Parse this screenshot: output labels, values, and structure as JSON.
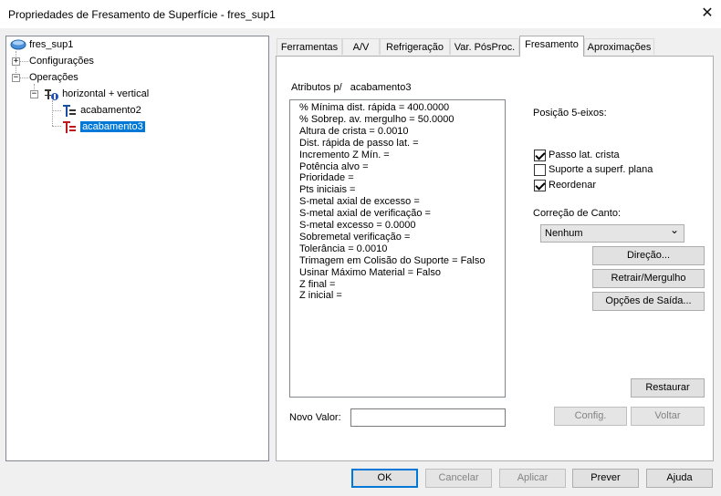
{
  "window": {
    "title": "Propriedades de Fresamento de Superfície - fres_sup1",
    "close_glyph": "✕"
  },
  "tree": {
    "root": "fres_sup1",
    "configuracoes": "Configurações",
    "operacoes": "Operações",
    "group": "horizontal + vertical",
    "items": [
      "acabamento2",
      "acabamento3"
    ],
    "selected": "acabamento3",
    "collapsed_glyph": "+",
    "expanded_glyph": "−"
  },
  "tabs": [
    "Ferramentas",
    "A/V",
    "Refrigeração",
    "Var. PósProc.",
    "Fresamento",
    "Aproximações"
  ],
  "active_tab": "Fresamento",
  "attributes": {
    "header": "Atributos p/   acabamento3",
    "lines": [
      "% Mínima dist. rápida = 400.0000",
      "% Sobrep. av. mergulho = 50.0000",
      "Altura de crista = 0.0010",
      "Dist. rápida de passo lat. =",
      "Incremento Z Mín. =",
      "Potência alvo =",
      "Prioridade =",
      "Pts iniciais =",
      "S-metal axial de excesso =",
      "S-metal axial de verificação =",
      "S-metal excesso = 0.0000",
      "Sobremetal verificação =",
      "Tolerância = 0.0010",
      "Trimagem em Colisão do Suporte = Falso",
      "Usinar Máximo Material = Falso",
      "Z final =",
      "Z inicial ="
    ]
  },
  "novo_valor": {
    "label": "Novo Valor:",
    "value": ""
  },
  "posicao": {
    "label": "Posição 5-eixos:",
    "checks": [
      {
        "label": "Passo lat. crista",
        "checked": true
      },
      {
        "label": "Suporte a superf. plana",
        "checked": false
      },
      {
        "label": "Reordenar",
        "checked": true
      }
    ]
  },
  "correcao": {
    "label": "Correção de Canto:",
    "value": "Nenhum",
    "arrow": "⌄"
  },
  "side_buttons": [
    "Direção...",
    "Retrair/Mergulho",
    "Opções de Saída..."
  ],
  "restaurar": "Restaurar",
  "config": "Config.",
  "voltar": "Voltar",
  "footer": {
    "ok": "OK",
    "cancelar": "Cancelar",
    "aplicar": "Aplicar",
    "prever": "Prever",
    "ajuda": "Ajuda"
  }
}
